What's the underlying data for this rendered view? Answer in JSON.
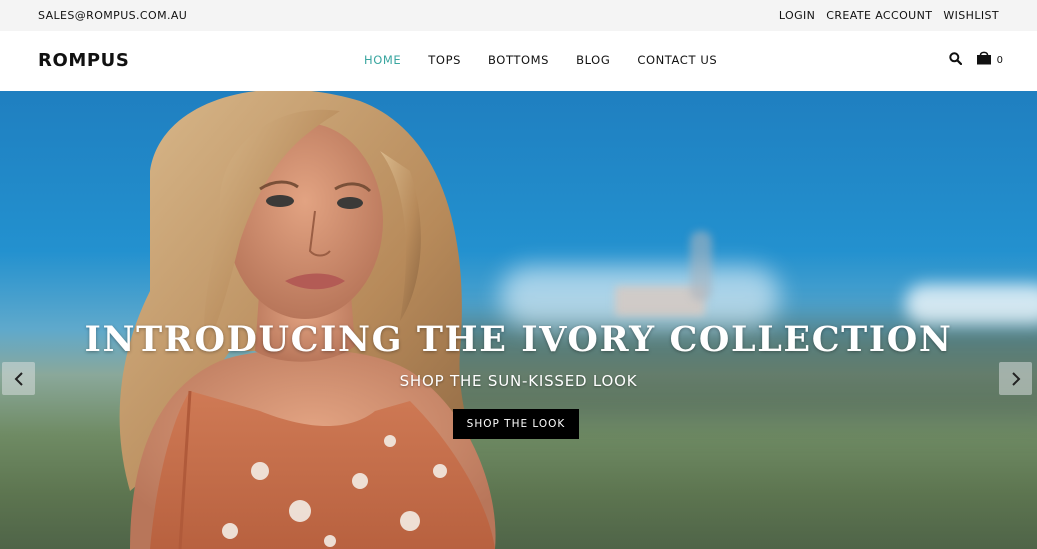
{
  "topbar": {
    "email": "SALES@ROMPUS.COM.AU",
    "links": [
      "LOGIN",
      "CREATE ACCOUNT",
      "WISHLIST"
    ]
  },
  "header": {
    "logo": "ROMPUS",
    "nav": [
      "HOME",
      "TOPS",
      "BOTTOMS",
      "BLOG",
      "CONTACT US"
    ],
    "active_nav": "HOME",
    "cart_count": "0",
    "icons": [
      "search-icon",
      "cart-icon"
    ]
  },
  "hero": {
    "title": "INTRODUCING THE IVORY COLLECTION",
    "subtitle": "SHOP THE SUN-KISSED LOOK",
    "button": "SHOP THE LOOK",
    "arrows": [
      "chevron-left-icon",
      "chevron-right-icon"
    ]
  },
  "colors": {
    "accent": "#3aa6a0",
    "topbar_bg": "#f4f4f4",
    "button_bg": "#000000"
  }
}
